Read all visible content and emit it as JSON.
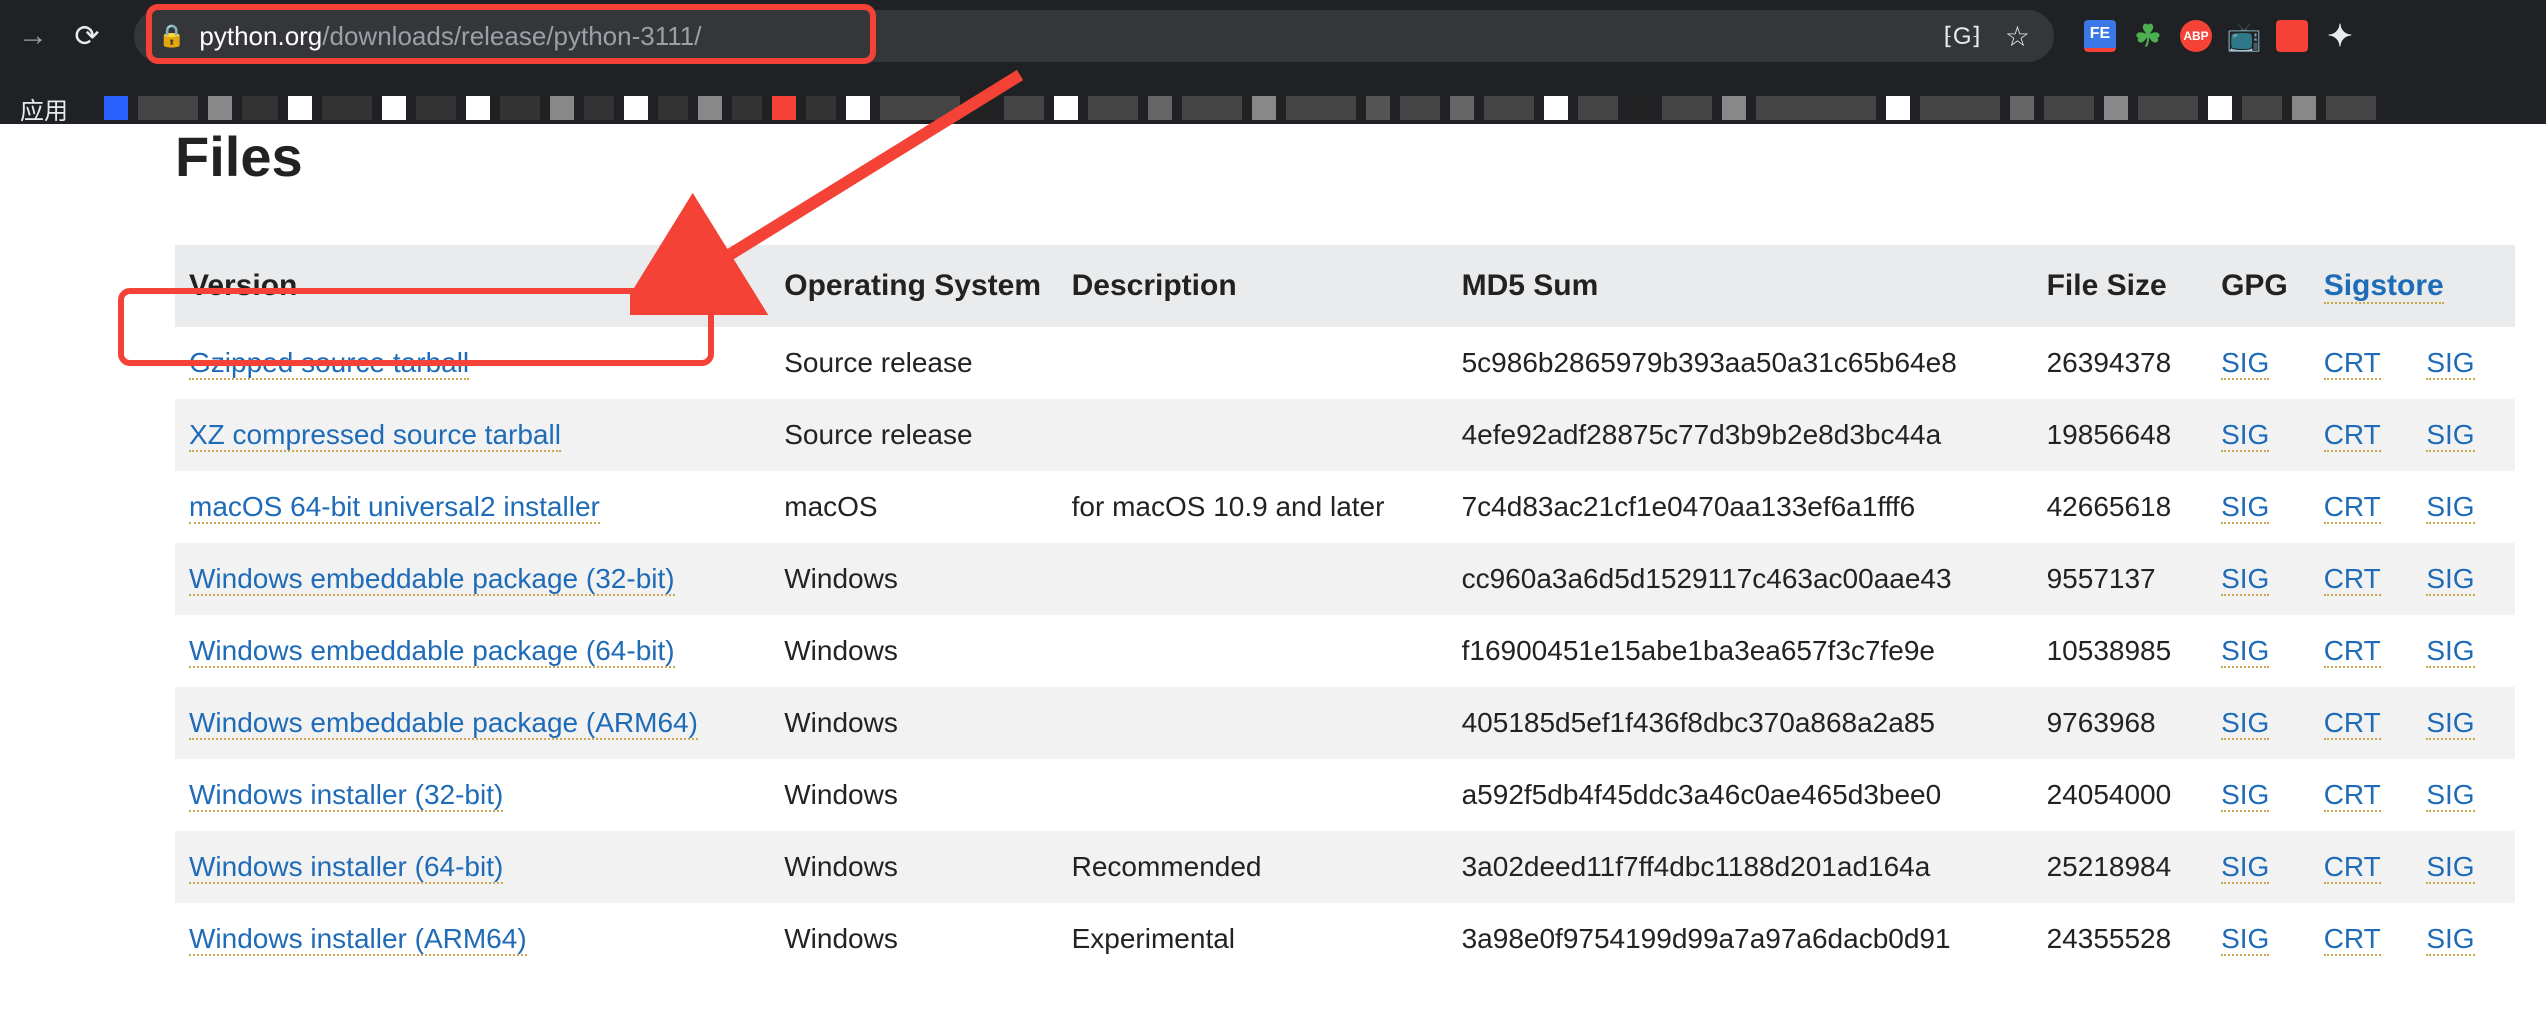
{
  "browser": {
    "url_domain": "python.org",
    "url_path": "/downloads/release/python-3111/",
    "apps_label": "应用",
    "ext_fe": "FE",
    "ext_abp": "ABP"
  },
  "page": {
    "heading": "Files"
  },
  "table": {
    "headers": {
      "version": "Version",
      "os": "Operating System",
      "desc": "Description",
      "md5": "MD5 Sum",
      "size": "File Size",
      "gpg": "GPG",
      "sigstore": "Sigstore"
    },
    "rows": [
      {
        "version": "Gzipped source tarball",
        "os": "Source release",
        "desc": "",
        "md5": "5c986b2865979b393aa50a31c65b64e8",
        "size": "26394378",
        "gpg": "SIG",
        "sig1": "CRT",
        "sig2": "SIG"
      },
      {
        "version": "XZ compressed source tarball",
        "os": "Source release",
        "desc": "",
        "md5": "4efe92adf28875c77d3b9b2e8d3bc44a",
        "size": "19856648",
        "gpg": "SIG",
        "sig1": "CRT",
        "sig2": "SIG"
      },
      {
        "version": "macOS 64-bit universal2 installer",
        "os": "macOS",
        "desc": "for macOS 10.9 and later",
        "md5": "7c4d83ac21cf1e0470aa133ef6a1fff6",
        "size": "42665618",
        "gpg": "SIG",
        "sig1": "CRT",
        "sig2": "SIG"
      },
      {
        "version": "Windows embeddable package (32-bit)",
        "os": "Windows",
        "desc": "",
        "md5": "cc960a3a6d5d1529117c463ac00aae43",
        "size": "9557137",
        "gpg": "SIG",
        "sig1": "CRT",
        "sig2": "SIG"
      },
      {
        "version": "Windows embeddable package (64-bit)",
        "os": "Windows",
        "desc": "",
        "md5": "f16900451e15abe1ba3ea657f3c7fe9e",
        "size": "10538985",
        "gpg": "SIG",
        "sig1": "CRT",
        "sig2": "SIG"
      },
      {
        "version": "Windows embeddable package (ARM64)",
        "os": "Windows",
        "desc": "",
        "md5": "405185d5ef1f436f8dbc370a868a2a85",
        "size": "9763968",
        "gpg": "SIG",
        "sig1": "CRT",
        "sig2": "SIG"
      },
      {
        "version": "Windows installer (32-bit)",
        "os": "Windows",
        "desc": "",
        "md5": "a592f5db4f45ddc3a46c0ae465d3bee0",
        "size": "24054000",
        "gpg": "SIG",
        "sig1": "CRT",
        "sig2": "SIG"
      },
      {
        "version": "Windows installer (64-bit)",
        "os": "Windows",
        "desc": "Recommended",
        "md5": "3a02deed11f7ff4dbc1188d201ad164a",
        "size": "25218984",
        "gpg": "SIG",
        "sig1": "CRT",
        "sig2": "SIG"
      },
      {
        "version": "Windows installer (ARM64)",
        "os": "Windows",
        "desc": "Experimental",
        "md5": "3a98e0f9754199d99a7a97a6dacb0d91",
        "size": "24355528",
        "gpg": "SIG",
        "sig1": "CRT",
        "sig2": "SIG"
      }
    ]
  }
}
